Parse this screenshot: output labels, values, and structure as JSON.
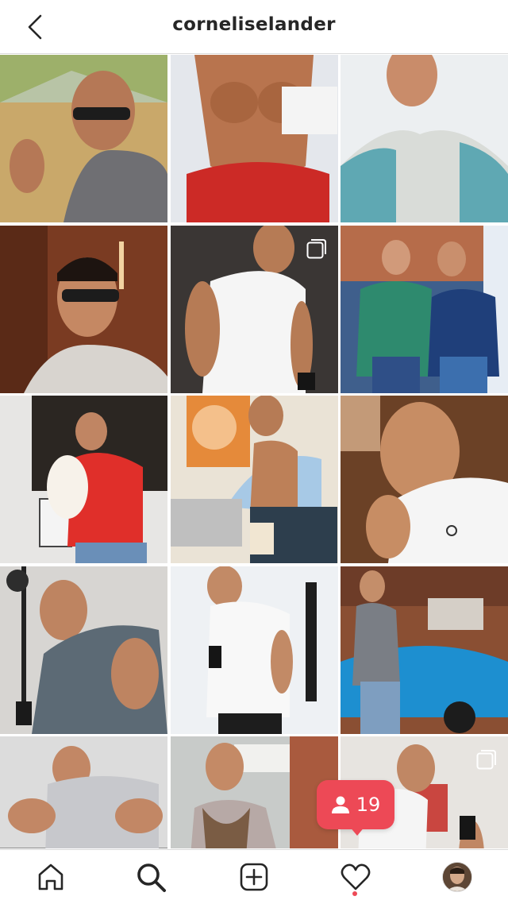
{
  "app": {
    "accent_color": "#ed4956",
    "text_color": "#262626"
  },
  "header": {
    "username": "corneliselander",
    "back_icon": "chevron-left-icon"
  },
  "grid": {
    "posts": [
      {
        "id": 1,
        "scene": "outdoor selfie, sunglasses, thumbs up",
        "multiple": false
      },
      {
        "id": 2,
        "scene": "shirtless torso, red shorts",
        "multiple": false
      },
      {
        "id": 3,
        "scene": "raglan shirt selfie",
        "multiple": false
      },
      {
        "id": 4,
        "scene": "selfie in wood-paneled room, sunglasses",
        "multiple": false
      },
      {
        "id": 5,
        "scene": "white t-shirt mirror pose",
        "multiple": true
      },
      {
        "id": 6,
        "scene": "two men in jackets on street",
        "multiple": false
      },
      {
        "id": 7,
        "scene": "holding small white dog, red t-shirt",
        "multiple": false
      },
      {
        "id": 8,
        "scene": "open shirt in kitchen",
        "multiple": false
      },
      {
        "id": 9,
        "scene": "thumbs up, white tank top",
        "multiple": false
      },
      {
        "id": 10,
        "scene": "gym cable workout, grey t-shirt",
        "multiple": false
      },
      {
        "id": 11,
        "scene": "mirror selfie, white t-shirt",
        "multiple": false
      },
      {
        "id": 12,
        "scene": "grey henley next to blue sports car",
        "multiple": false
      },
      {
        "id": 13,
        "scene": "flexing in gym, grey t-shirt",
        "multiple": false
      },
      {
        "id": 14,
        "scene": "fur-collar jacket on street",
        "multiple": false
      },
      {
        "id": 15,
        "scene": "white t-shirt mirror selfie at home",
        "multiple": true
      }
    ]
  },
  "follower_notification": {
    "count": "19",
    "icon": "person-icon"
  },
  "tabbar": {
    "items": [
      {
        "name": "home",
        "icon": "home-icon"
      },
      {
        "name": "search",
        "icon": "search-icon",
        "active": true
      },
      {
        "name": "new-post",
        "icon": "plus-square-icon"
      },
      {
        "name": "activity",
        "icon": "heart-icon",
        "has_notification": true
      },
      {
        "name": "profile",
        "icon": "avatar"
      }
    ]
  }
}
